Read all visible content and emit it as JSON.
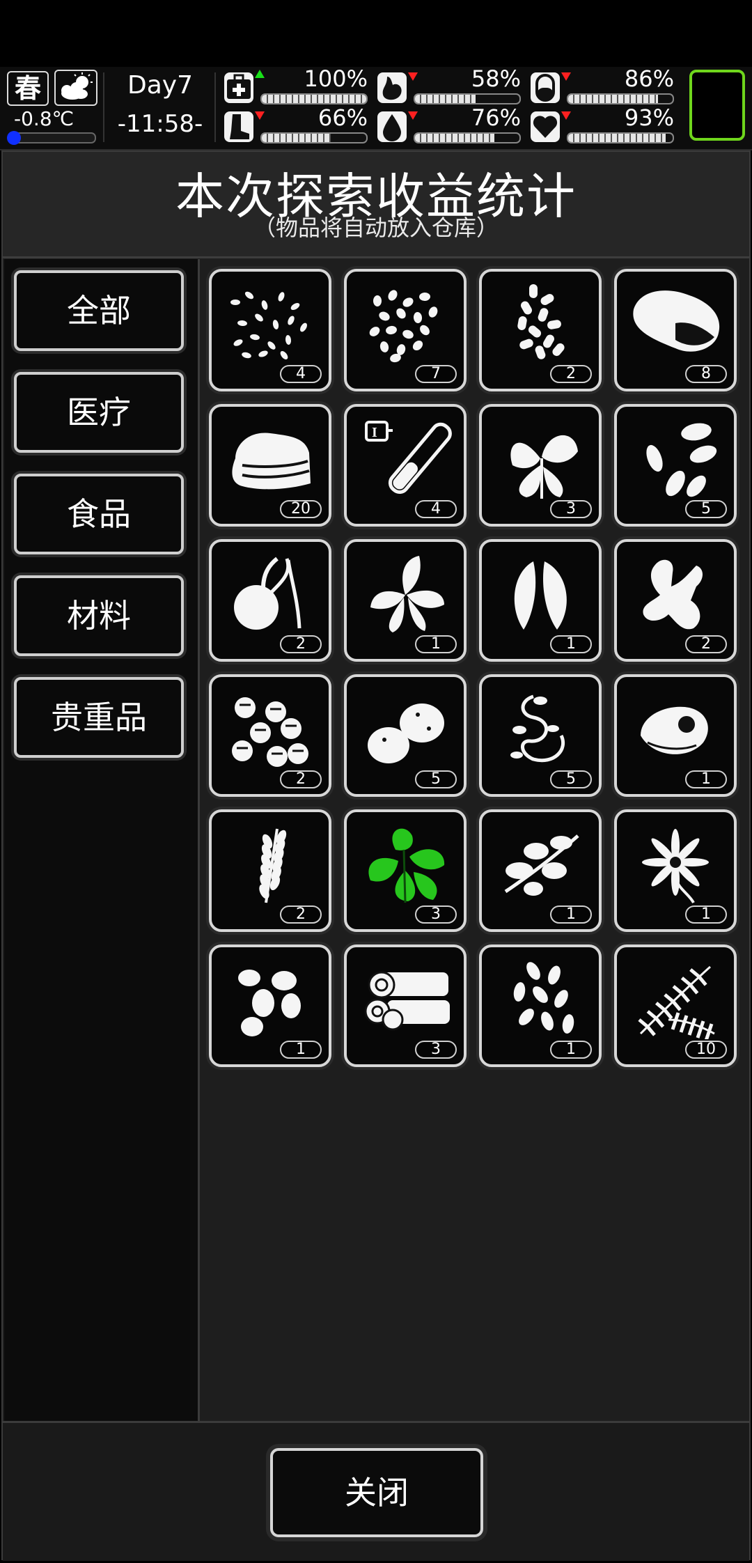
{
  "status": {
    "season": "春",
    "weather_icon": "partly-cloudy-icon",
    "temperature": "-0.8℃",
    "day": "Day7",
    "clock": "-11:58-",
    "stats": [
      {
        "icon": "first-aid-icon",
        "trend": "up",
        "percent": "100%",
        "level": 1.0
      },
      {
        "icon": "stomach-icon",
        "trend": "down",
        "percent": "58%",
        "level": 0.58
      },
      {
        "icon": "pill-icon",
        "trend": "down",
        "percent": "86%",
        "level": 0.86
      },
      {
        "icon": "foot-icon",
        "trend": "down",
        "percent": "66%",
        "level": 0.66
      },
      {
        "icon": "water-drop-icon",
        "trend": "down",
        "percent": "76%",
        "level": 0.76
      },
      {
        "icon": "heart-icon",
        "trend": "down",
        "percent": "93%",
        "level": 0.93
      }
    ]
  },
  "panel": {
    "title": "本次探索收益统计",
    "subtitle": "（物品将自动放入仓库）"
  },
  "categories": [
    {
      "label": "全部",
      "active": true
    },
    {
      "label": "医疗",
      "active": false
    },
    {
      "label": "食品",
      "active": false
    },
    {
      "label": "材料",
      "active": false
    },
    {
      "label": "贵重品",
      "active": false
    }
  ],
  "items": [
    {
      "icon": "rice-grains-icon",
      "count": "4"
    },
    {
      "icon": "seeds-icon",
      "count": "7"
    },
    {
      "icon": "pills-capsules-icon",
      "count": "2"
    },
    {
      "icon": "sweet-potato-icon",
      "count": "8"
    },
    {
      "icon": "cloth-stack-icon",
      "count": "20"
    },
    {
      "icon": "test-tube-icon",
      "count": "4"
    },
    {
      "icon": "herb-leaves-icon",
      "count": "3"
    },
    {
      "icon": "almonds-icon",
      "count": "5"
    },
    {
      "icon": "sprouting-bulb-icon",
      "count": "2"
    },
    {
      "icon": "mint-leaves-icon",
      "count": "1"
    },
    {
      "icon": "bay-leaves-icon",
      "count": "1"
    },
    {
      "icon": "ginger-root-icon",
      "count": "2"
    },
    {
      "icon": "chestnuts-icon",
      "count": "2"
    },
    {
      "icon": "potatoes-icon",
      "count": "5"
    },
    {
      "icon": "vine-tendril-icon",
      "count": "5"
    },
    {
      "icon": "mushroom-cap-icon",
      "count": "1"
    },
    {
      "icon": "wheat-ear-icon",
      "count": "2"
    },
    {
      "icon": "green-herb-icon",
      "count": "3"
    },
    {
      "icon": "berry-branch-icon",
      "count": "1"
    },
    {
      "icon": "star-flower-icon",
      "count": "1"
    },
    {
      "icon": "pine-nuts-icon",
      "count": "1"
    },
    {
      "icon": "wood-logs-icon",
      "count": "3"
    },
    {
      "icon": "petals-icon",
      "count": "1"
    },
    {
      "icon": "fern-icon",
      "count": "10"
    }
  ],
  "footer": {
    "close_label": "关闭"
  }
}
